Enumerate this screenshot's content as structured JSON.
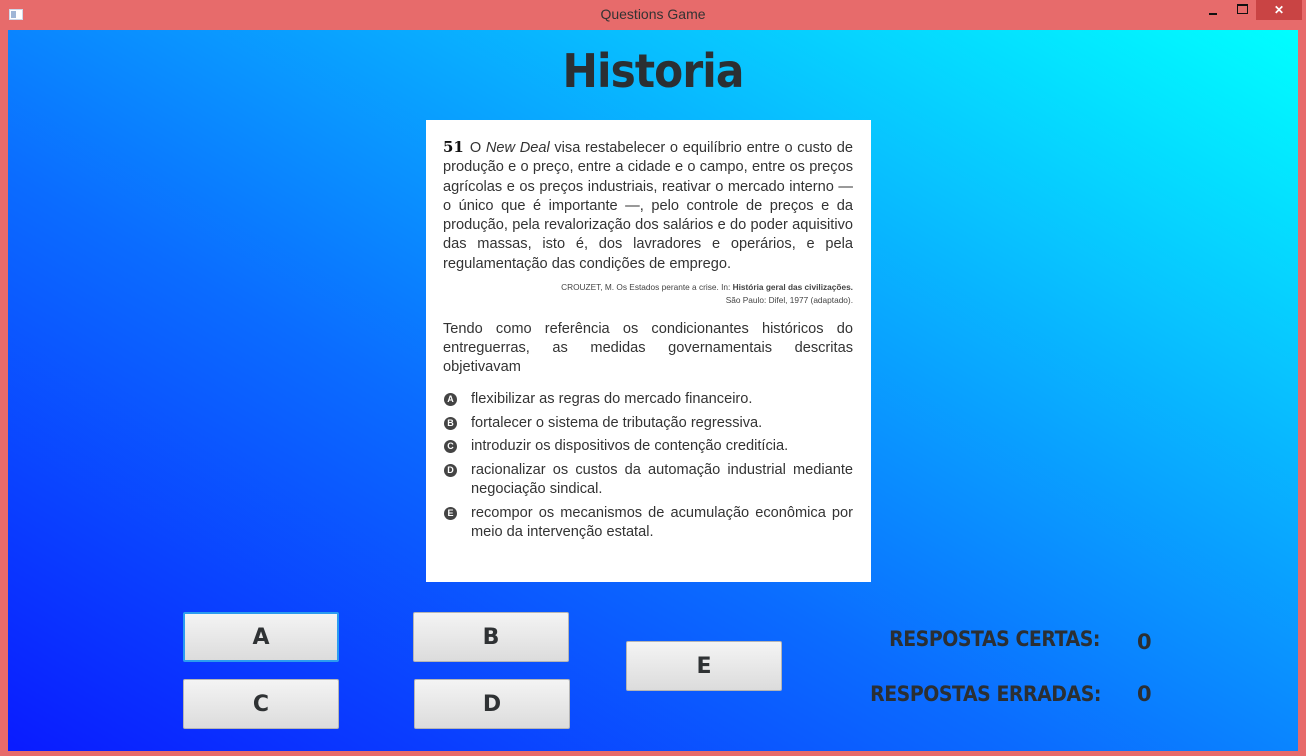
{
  "window": {
    "title": "Questions Game",
    "minimize_glyph": "",
    "close_glyph": "✕"
  },
  "subject": "Historia",
  "question": {
    "number": "51",
    "stem_part1": "O ",
    "stem_italic": "New Deal",
    "stem_part2": " visa restabelecer o equilíbrio entre o custo de produção e o preço, entre a cidade e o campo, entre os preços agrícolas e os preços industriais, reativar o mercado interno — o único que é importante —, pelo controle de preços e da produção, pela revalorização dos salários e do poder aquisitivo das massas, isto é, dos lavradores e operários, e pela regulamentação das condições de emprego.",
    "citation_part1": "CROUZET, M. Os Estados perante a crise. In: ",
    "citation_bold": "História geral das civilizações.",
    "citation_part2": "São Paulo: Difel, 1977 (adaptado).",
    "prompt": "Tendo como referência os condicionantes históricos do entreguerras, as medidas governamentais descritas objetivavam",
    "options": [
      {
        "letter": "A",
        "text": "flexibilizar as regras do mercado financeiro."
      },
      {
        "letter": "B",
        "text": "fortalecer o sistema de tributação regressiva."
      },
      {
        "letter": "C",
        "text": "introduzir os dispositivos de contenção creditícia."
      },
      {
        "letter": "D",
        "text": "racionalizar os custos da automação industrial mediante negociação sindical."
      },
      {
        "letter": "E",
        "text": "recompor os mecanismos de acumulação econômica por meio da intervenção estatal."
      }
    ]
  },
  "buttons": {
    "a": "A",
    "b": "B",
    "c": "C",
    "d": "D",
    "e": "E"
  },
  "score": {
    "correct_label": "RESPOSTAS CERTAS:",
    "correct_value": "0",
    "wrong_label": "RESPOSTAS ERRADAS:",
    "wrong_value": "0"
  },
  "colors": {
    "titlebar": "#e76b6b",
    "gradient_start": "#0a1bff",
    "gradient_end": "#00ffff",
    "text_dark": "#2b2f33"
  }
}
